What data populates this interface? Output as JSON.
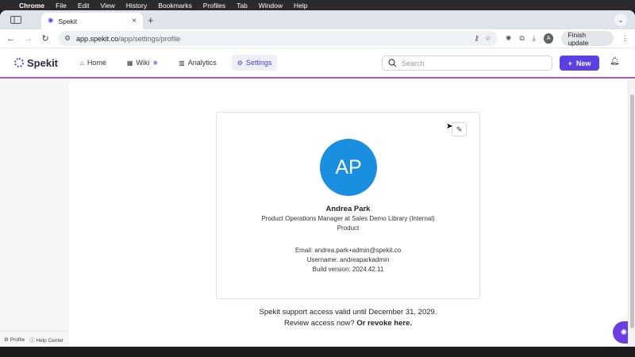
{
  "menubar": {
    "app": "Chrome",
    "items": [
      "File",
      "Edit",
      "View",
      "History",
      "Bookmarks",
      "Profiles",
      "Tab",
      "Window",
      "Help"
    ]
  },
  "browser": {
    "tab_title": "Spekit",
    "url_host": "app.spekit.co",
    "url_path": "/app/settings/profile",
    "profile_initial": "A",
    "finish_update": "Finish update"
  },
  "app": {
    "logo": "Spekit",
    "nav": [
      {
        "label": "Home",
        "icon": "home-icon"
      },
      {
        "label": "Wiki",
        "icon": "grid-icon"
      },
      {
        "label": "Analytics",
        "icon": "bar-chart-icon"
      },
      {
        "label": "Settings",
        "icon": "gear-icon"
      }
    ],
    "search_placeholder": "Search",
    "new_label": "New"
  },
  "profile": {
    "initials": "AP",
    "name": "Andrea Park",
    "title": "Product Operations Manager at Sales Demo Library (Internal)",
    "team": "Product",
    "email": "Email: andrea.park+admin@spekit.co",
    "username": "Username: andreaparkadmin",
    "build": "Build version: 2024.42.11"
  },
  "support": {
    "line1": "Spekit support access valid until December 31, 2029.",
    "line2_prefix": "Review access now?",
    "line2_link": "Or revoke here."
  },
  "footer": {
    "profile": "Profile",
    "help": "Help Center"
  },
  "colors": {
    "accent": "#5b40e6",
    "avatar": "#1a8fe0",
    "divider": "#b054d6"
  }
}
